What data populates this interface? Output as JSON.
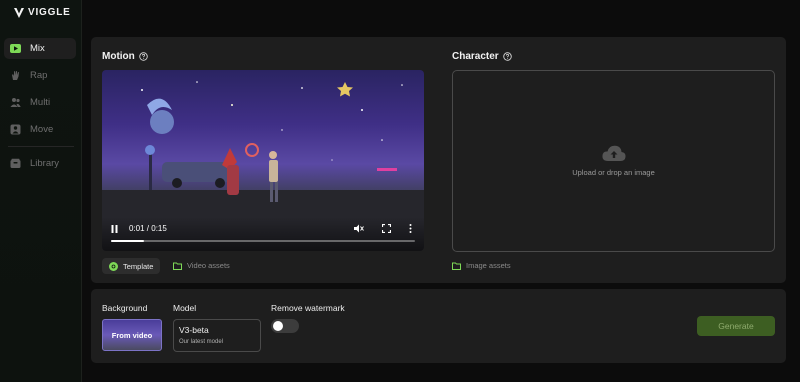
{
  "brand": {
    "name": "VIGGLE"
  },
  "colors": {
    "accent": "#7ed957",
    "generate_bg": "#3d5e22"
  },
  "nav": {
    "items": [
      {
        "label": "Mix",
        "icon": "play-icon",
        "active": true
      },
      {
        "label": "Rap",
        "icon": "hand-icon",
        "active": false
      },
      {
        "label": "Multi",
        "icon": "people-icon",
        "active": false
      },
      {
        "label": "Move",
        "icon": "person-icon",
        "active": false
      },
      {
        "label": "Library",
        "icon": "box-icon",
        "active": false
      }
    ]
  },
  "motion": {
    "title": "Motion",
    "video": {
      "time": "0:01 / 0:15",
      "progress": 0.11,
      "muted": true,
      "playing": true
    },
    "template_label": "Template",
    "assets_label": "Video assets"
  },
  "character": {
    "title": "Character",
    "upload_text": "Upload or drop an image",
    "assets_label": "Image assets"
  },
  "settings": {
    "background_label": "Background",
    "background_value": "From video",
    "model_label": "Model",
    "model_name": "V3-beta",
    "model_desc": "Our latest model",
    "watermark_label": "Remove watermark",
    "watermark_enabled": false,
    "generate_label": "Generate"
  }
}
